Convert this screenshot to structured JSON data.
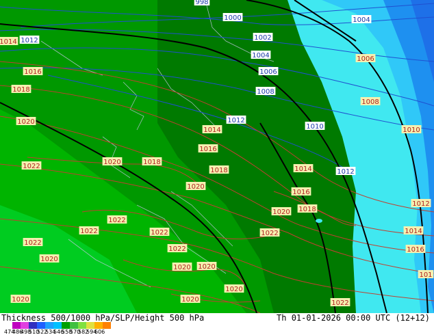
{
  "footer": {
    "title": "Thickness 500/1000 hPa/SLP/Height 500 hPa",
    "valid_time": "Th 01-01-2026 00:00 UTC (12+12)",
    "scale_ticks": [
      "474",
      "486",
      "498",
      "510",
      "522",
      "534",
      "546",
      "558",
      "570",
      "582",
      "594",
      "606"
    ],
    "scale_colors": [
      "#c000c0",
      "#e040e0",
      "#3030c0",
      "#2060ff",
      "#20a0ff",
      "#00c0ff",
      "#00a000",
      "#40c040",
      "#80e040",
      "#e0e040",
      "#ffb000",
      "#ff8000"
    ]
  },
  "colors": {
    "dark_green": "#007a00",
    "mid_green": "#009800",
    "light_green": "#00b400",
    "bright_green": "#00cc20",
    "cyan": "#40e8f0",
    "sky": "#30a8f8",
    "blue": "#1e78f0",
    "isobar_blue": "#2050d0",
    "isobar_red": "#c04030"
  },
  "blue_labels": [
    {
      "text": "998"
    },
    {
      "text": "1000"
    },
    {
      "text": "1002"
    },
    {
      "text": "1004"
    },
    {
      "text": "1004"
    },
    {
      "text": "1006"
    },
    {
      "text": "1008"
    },
    {
      "text": "1010"
    },
    {
      "text": "1012"
    },
    {
      "text": "1012"
    },
    {
      "text": "1012"
    },
    {
      "text": "1012"
    }
  ],
  "red_labels": [
    {
      "text": "1014"
    },
    {
      "text": "1016"
    },
    {
      "text": "1018"
    },
    {
      "text": "1020"
    },
    {
      "text": "1022"
    },
    {
      "text": "1020"
    },
    {
      "text": "1018"
    },
    {
      "text": "1014"
    },
    {
      "text": "1016"
    },
    {
      "text": "1018"
    },
    {
      "text": "1020"
    },
    {
      "text": "1014"
    },
    {
      "text": "1016"
    },
    {
      "text": "1018"
    },
    {
      "text": "1020"
    },
    {
      "text": "1022"
    },
    {
      "text": "1022"
    },
    {
      "text": "1022"
    },
    {
      "text": "1022"
    },
    {
      "text": "1022"
    },
    {
      "text": "1020"
    },
    {
      "text": "1022"
    },
    {
      "text": "1020"
    },
    {
      "text": "1020"
    },
    {
      "text": "1020"
    },
    {
      "text": "1020"
    },
    {
      "text": "1020"
    },
    {
      "text": "1022"
    },
    {
      "text": "1006"
    },
    {
      "text": "1008"
    },
    {
      "text": "1010"
    },
    {
      "text": "1012"
    },
    {
      "text": "1014"
    },
    {
      "text": "1016"
    },
    {
      "text": "101"
    }
  ]
}
